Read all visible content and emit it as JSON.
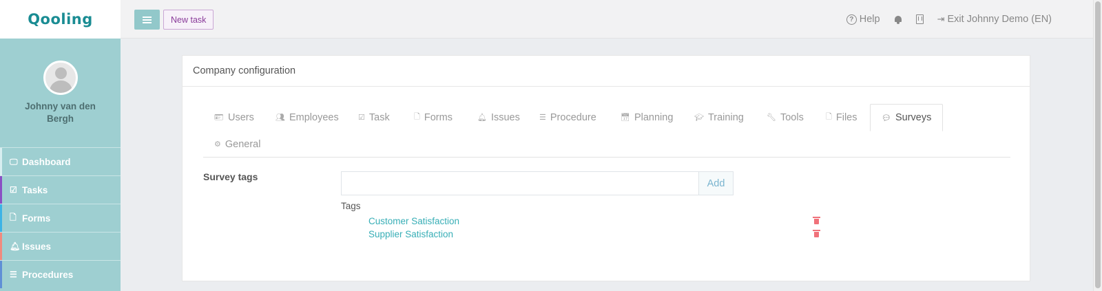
{
  "app": {
    "logo": "Qooling"
  },
  "sidebar": {
    "user_name": "Johnny van den Bergh",
    "items": [
      {
        "label": "Dashboard",
        "icon": "monitor-icon",
        "bar": "#d8eef0"
      },
      {
        "label": "Tasks",
        "icon": "check-square-icon",
        "bar": "#8a4fc4"
      },
      {
        "label": "Forms",
        "icon": "file-icon",
        "bar": "#3cb3e6"
      },
      {
        "label": "Issues",
        "icon": "bell-icon",
        "bar": "#f08a7e"
      },
      {
        "label": "Procedures",
        "icon": "list-icon",
        "bar": "#5f8fd6"
      }
    ]
  },
  "topbar": {
    "new_task_label": "New task",
    "help_label": "Help",
    "exit_label": "Exit Johnny Demo (EN)"
  },
  "card": {
    "title": "Company configuration",
    "tabs": [
      {
        "label": "Users",
        "icon": "id-card-icon"
      },
      {
        "label": "Employees",
        "icon": "users-icon"
      },
      {
        "label": "Task",
        "icon": "check-square-icon"
      },
      {
        "label": "Forms",
        "icon": "file-icon"
      },
      {
        "label": "Issues",
        "icon": "bell-icon"
      },
      {
        "label": "Procedure",
        "icon": "list-icon"
      },
      {
        "label": "Planning",
        "icon": "calendar-check-icon"
      },
      {
        "label": "Training",
        "icon": "graduation-cap-icon"
      },
      {
        "label": "Tools",
        "icon": "wrench-icon"
      },
      {
        "label": "Files",
        "icon": "file-icon"
      },
      {
        "label": "Surveys",
        "icon": "comment-icon",
        "active": true
      },
      {
        "label": "General",
        "icon": "gear-icon"
      }
    ],
    "survey_tags": {
      "section_label": "Survey tags",
      "input_value": "",
      "add_label": "Add",
      "tags_label": "Tags",
      "tags": [
        "Customer Satisfaction",
        "Supplier Satisfaction"
      ]
    }
  }
}
